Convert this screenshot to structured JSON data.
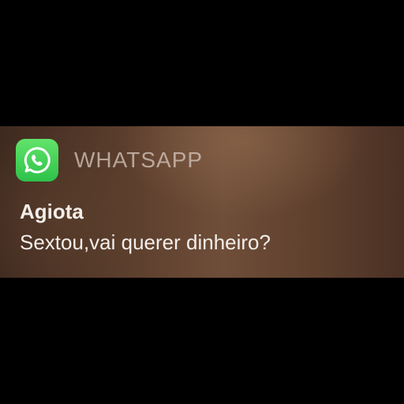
{
  "notification": {
    "app_icon": "whatsapp-icon",
    "app_name": "WHATSAPP",
    "sender": "Agiota",
    "message": "Sextou,vai querer dinheiro?"
  },
  "colors": {
    "background": "#000000",
    "icon_green": "#3fcf56",
    "banner_brown": "#5a3d2c"
  }
}
